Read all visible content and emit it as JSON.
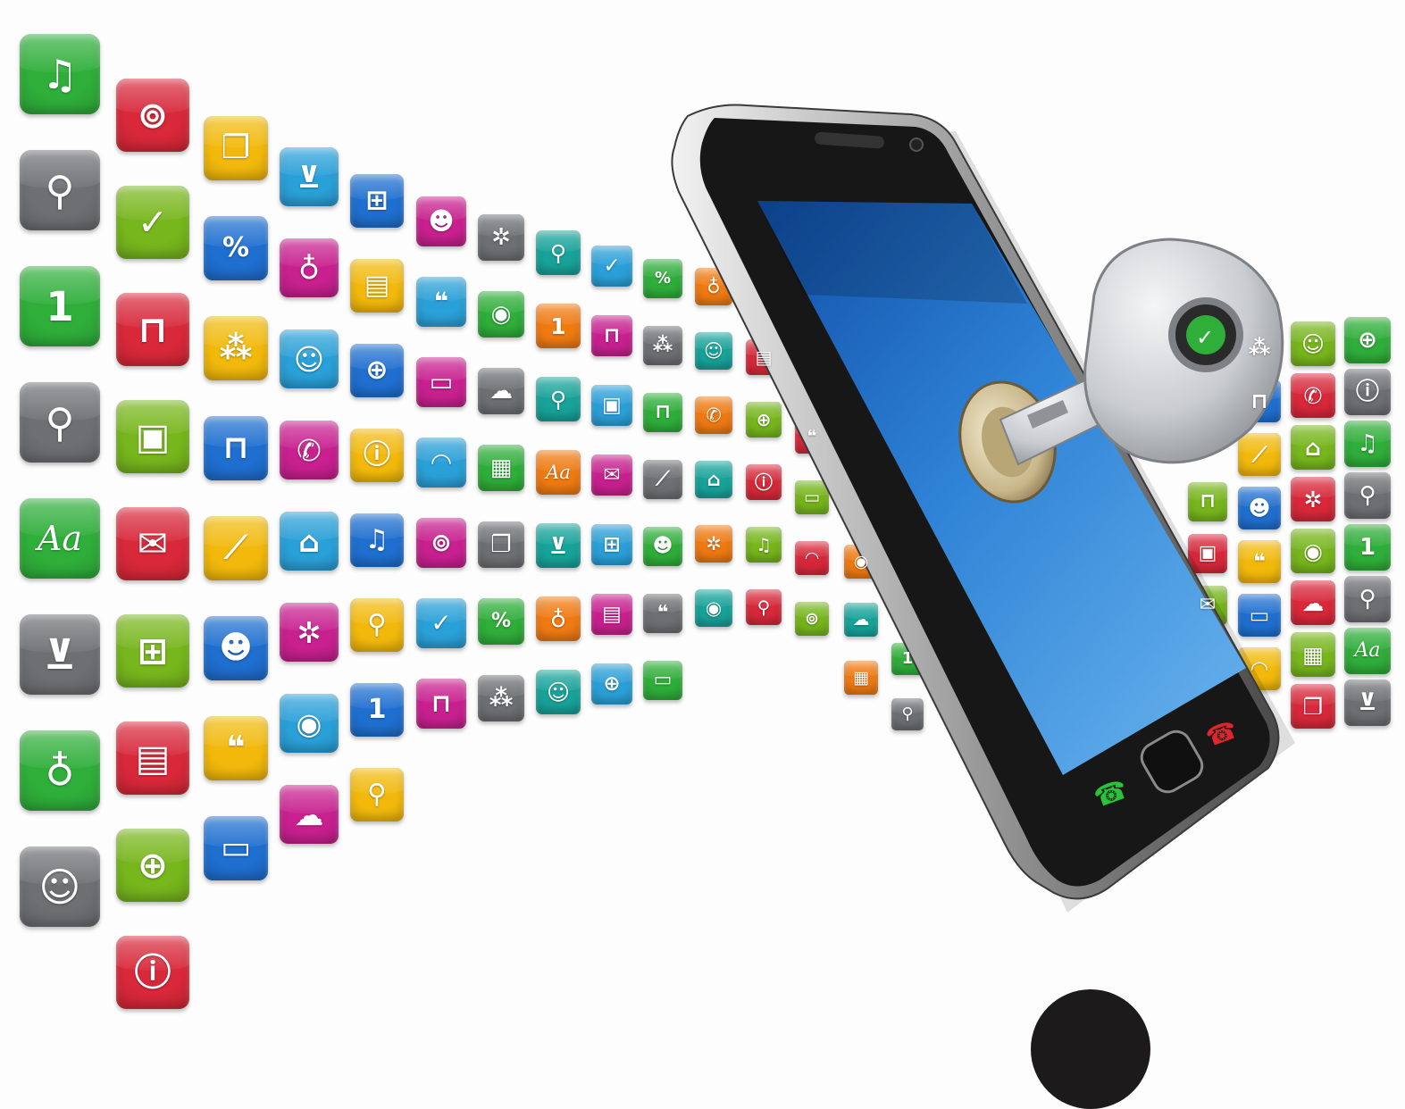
{
  "scene": {
    "background": "#fdfdfd",
    "icon_colors": {
      "green": "#2fae3a",
      "blue": "#1f6fd0",
      "orange": "#f07a12",
      "red": "#d8283a",
      "magenta": "#c8208f",
      "purple": "#7a34c2",
      "gray": "#6d6f73",
      "yellow": "#f2b90c",
      "teal": "#17a39a",
      "lime": "#77b61c",
      "sky": "#2aa0d8",
      "indigo": "#4a56c9"
    },
    "icon_types": [
      "music-note-icon",
      "camera-icon",
      "rss-feed-icon",
      "search-icon",
      "weather-cloud-icon",
      "dining-icon",
      "calendar-icon",
      "calculator-icon",
      "checkmark-icon",
      "pushpin-icon",
      "windows-icon",
      "unlock-icon",
      "font-icon",
      "percent-icon",
      "film-icon",
      "cart-icon",
      "puzzle-icon",
      "mail-icon",
      "broadcast-icon",
      "lock-icon",
      "network-icon",
      "smiley-icon",
      "chart-icon",
      "clapper-icon",
      "phone-icon",
      "contact-icon",
      "globe-icon",
      "home-icon",
      "chat-icon",
      "info-icon",
      "gears-icon",
      "message-icon"
    ],
    "glyphs": {
      "font-icon": "Aa",
      "percent-icon": "%",
      "calendar-icon": "1"
    },
    "phone": {
      "body_color": "#1a1a1a",
      "screen_color": "#2f83d6",
      "call_accept_color": "#27c43a",
      "call_reject_color": "#e0262c"
    },
    "key": {
      "color": "#c9ccd0"
    },
    "dot": {
      "color": "#1c1a1a"
    }
  }
}
